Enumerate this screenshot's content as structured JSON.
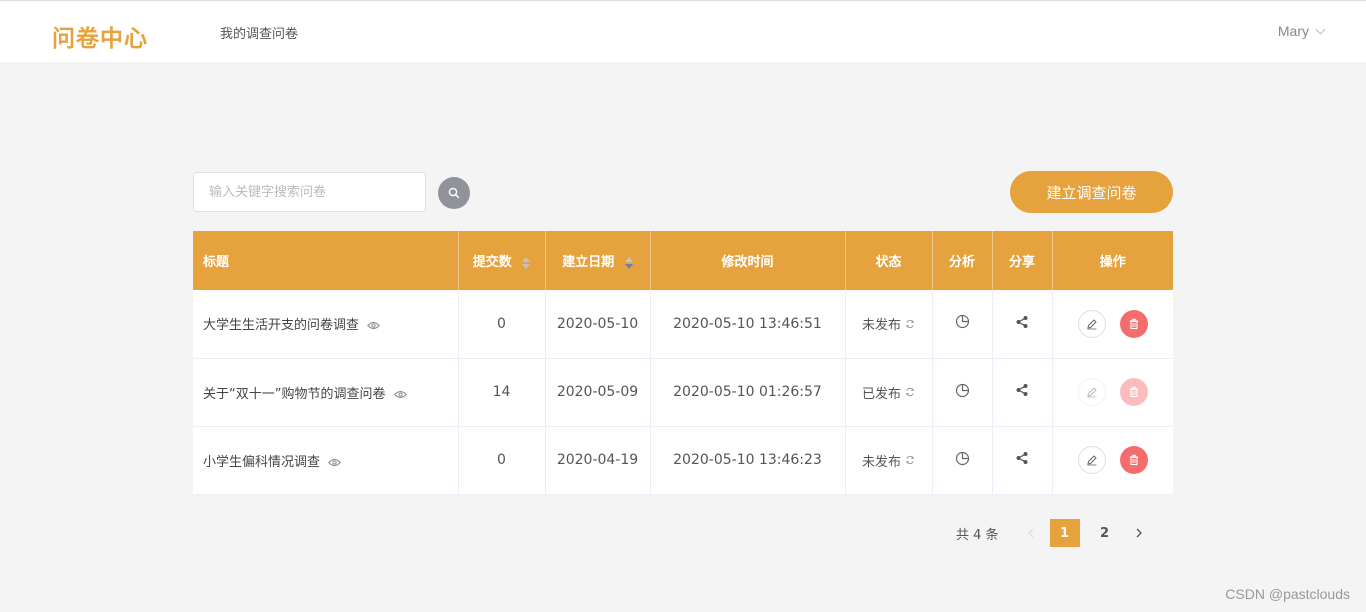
{
  "header": {
    "logo": "问卷中心",
    "nav": "我的调查问卷",
    "user": "Mary"
  },
  "toolbar": {
    "search_placeholder": "输入关键字搜索问卷",
    "create_label": "建立调查问卷"
  },
  "table": {
    "columns": [
      "标题",
      "提交数",
      "建立日期",
      "修改时间",
      "状态",
      "分析",
      "分享",
      "操作"
    ],
    "rows": [
      {
        "title": "大学生生活开支的问卷调查",
        "submissions": "0",
        "created": "2020-05-10",
        "modified": "2020-05-10 13:46:51",
        "status": "未发布",
        "actions_enabled": true
      },
      {
        "title": "关于“双十一”购物节的调查问卷",
        "submissions": "14",
        "created": "2020-05-09",
        "modified": "2020-05-10 01:26:57",
        "status": "已发布",
        "actions_enabled": false
      },
      {
        "title": "小学生偏科情况调查",
        "submissions": "0",
        "created": "2020-04-19",
        "modified": "2020-05-10 13:46:23",
        "status": "未发布",
        "actions_enabled": true
      }
    ]
  },
  "pagination": {
    "total": "共 4 条",
    "pages": [
      "1",
      "2"
    ],
    "current": "1"
  },
  "watermark": "CSDN @pastclouds",
  "colors": {
    "accent": "#e6a23c",
    "danger": "#f56c6c",
    "search_button": "#909399"
  }
}
